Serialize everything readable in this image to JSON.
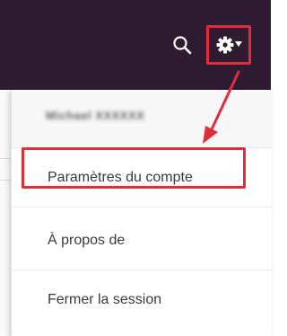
{
  "header": {
    "search_icon": "search-icon",
    "settings_icon": "gear-icon",
    "caret_icon": "caret-down-icon"
  },
  "menu": {
    "user_name": "Michael XXXXXX",
    "items": [
      {
        "label": "Paramètres du compte"
      },
      {
        "label": "À propos de"
      },
      {
        "label": "Fermer la session"
      }
    ]
  },
  "colors": {
    "header_bg": "#2f1c33",
    "highlight": "#e02d38",
    "text": "#3a3a3a"
  }
}
